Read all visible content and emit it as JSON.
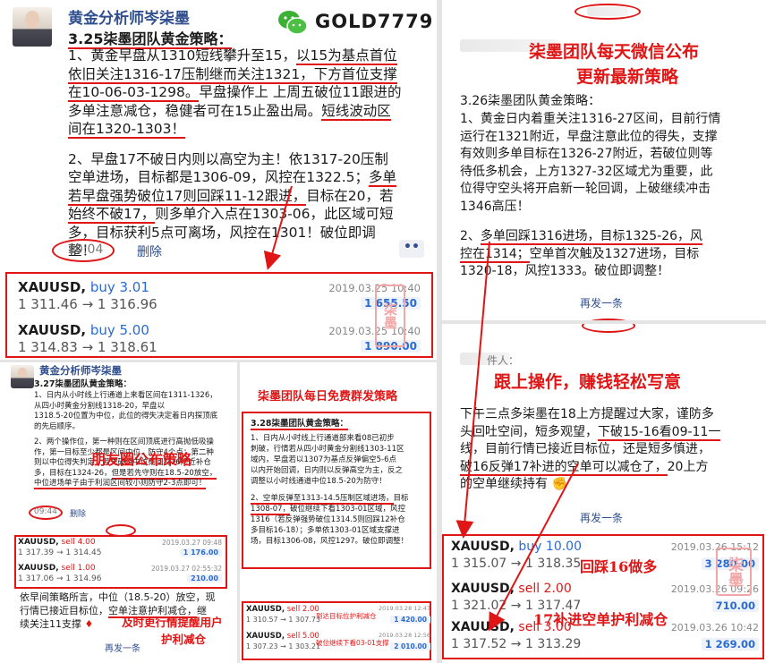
{
  "p1": {
    "author": "黄金分析师岑柒墨",
    "brand_wechat": "GOLD7779",
    "title": "3.25柒墨团队黄金策略：",
    "l1": "1、黄金早盘从1310短线攀升至15，",
    "l1u": "以15为基点首位",
    "l2u1": "依旧关注1316-17压制继而关注1321，",
    "l2u2": "下方首位支撑",
    "l3u": "在10-06-03-1298。",
    "l3": "早盘操作上 上周五破位11跟进的",
    "l4": "多单注意减仓，稳健者可在15止盈出局。",
    "l4u": "短线波动区",
    "l5u": "间在1320-1303！",
    "l6": "2、早盘17不破日内则以高空为主！依1317-20压制",
    "l7": "空单进场，目标都是1306-09，风控在1322.5；",
    "l7u": "多单",
    "l8u": "若早盘强势破位17则回踩11-12跟进，",
    "l8": "目标在20，若",
    "l9u": "始终不破17，",
    "l9": "则多单介入点在1303-06，此区域可短",
    "l10": "多，目标获利5点可离场，风控在1301！破位即调",
    "l11": "整！",
    "time": "10:04",
    "delete": "删除"
  },
  "trades_top": [
    {
      "symbol": "XAUUSD,",
      "side": "buy 3.01",
      "price": "1 311.46 → 1 316.96",
      "date": "2019.03.25 10:40",
      "profit": "1 655.50"
    },
    {
      "symbol": "XAUUSD,",
      "side": "buy 5.00",
      "price": "1 314.83 → 1 318.61",
      "date": "2019.03.25 10:40",
      "profit": "1 890.00"
    }
  ],
  "p2": {
    "author": "黄金分析师岑柒墨",
    "title": "3.27柒墨团队黄金策略：",
    "t1": "1、日内从小时线上行通道上来看区间在1311-1326，",
    "t2": "从四小时黄金分割线1318-20，早盘以",
    "t3": "1318.5-20位置为中位，此位的得失决定着日内探顶底",
    "t4": "的先后顺序。",
    "t5": "2、两个操作位，第一种则在区间顶底进行高抛低吸操",
    "t6": "作，第一目标至少都是区间中位，防守4个点；第二种",
    "t7": "则以中位得失判定，若先破位中位则回踩16附近补仓",
    "t8": "多，目标在1324-26，",
    "t8u": "但是若先守则在18.5-20放空，",
    "t9u": "中位进场单子由于利润区间较小则防守2-3点即可！",
    "annot": "朋友圈公布策略",
    "time": "09:44",
    "delete": "删除"
  },
  "trades_p2": [
    {
      "symbol": "XAUUSD,",
      "side": "sell 4.00",
      "price": "1 317.39 → 1 314.45",
      "date": "2019.03.27 09:48",
      "profit": "1 176.00"
    },
    {
      "symbol": "XAUUSD,",
      "side": "sell 1.00",
      "price": "1 317.06 → 1 314.96",
      "date": "2019.03.27 02:55:32",
      "profit": "210.00"
    }
  ],
  "p2foot": {
    "t1": "依早间策略所言，中位（18.5-20）放空，现",
    "t2": "行情已接近目标位，",
    "t2u": "空单注意护利减仓，",
    "t2b": "继",
    "t3": "续关注11支撑",
    "annot1": "及时更行情提醒用户",
    "annot2": "护利减仓",
    "more": "再发一条"
  },
  "p3": {
    "annot": "柒墨团队每日免费群发策略",
    "title": "3.28柒墨团队黄金策略：",
    "t1": "1、日内从小时线上行通道部来看08已初步",
    "t2": "刺破，行情若从四小时黄金分割线1303-11区",
    "t3": "域内，早盘若以1307为基点反弹偏空5-6点",
    "t4": "以内开始回调，日内则以反弹高空为主，反之",
    "t5": "调整以小时线通道中位18.5-20为防守！",
    "t6": "2、空单反弹至1313-14.5压制区域进场，",
    "t6b": "目标",
    "t7u": "1308-07，",
    "t7": "破位继续下看1303-01区域，风控",
    "t8": "1316（若反弹强势破位1314.5则回踩12补仓",
    "t9": "多目标16-18）；多单依1303-01区域支撑进",
    "t10": "场，目标1306-08，风控1297。破位即调整！"
  },
  "trades_p3": [
    {
      "symbol": "XAUUSD,",
      "side": "sell 2.00",
      "price": "1 310.57 → 1 307.73",
      "annot": "到达目标位护利减仓",
      "date": "2019.03.28 12:47",
      "profit": "1 420.00"
    },
    {
      "symbol": "XAUUSD,",
      "side": "sell 5.00",
      "price": "1 307.23 → 1 303.21",
      "annot": "破位继续下看03-01支撑",
      "date": "2019.03.28 12:56",
      "profit": "2 010.00"
    }
  ],
  "p4": {
    "date_blur": "2019.03.26",
    "annot1": "柒墨团队每天微信公布",
    "annot2": "更新最新策略",
    "title": "3.26柒墨团队黄金策略：",
    "t1": "1、黄金日内着重关注1316-27区间，目前行情",
    "t2": "运行在1321附近，早盘注意此位的得失，支撑",
    "t3": "有效则多单目标在1326-27附近，若破位则等",
    "t4": "待低多机会，上方1327-32区域尤为重要，此",
    "t5": "位得守空头将开启新一轮回调，上破继续冲击",
    "t6": "1346高压！",
    "t7a": "2、",
    "t7u": "多单回踩1316进场，目标1325-26，风",
    "t8u": "控在1314；",
    "t8": "空单首次触及1327进场，目标",
    "t9": "1320-18，风控1333。破位即调整！",
    "more": "再发一条"
  },
  "p5": {
    "header": "件人：",
    "annot": "跟上操作，赚钱轻松写意",
    "t1": "下午三点多柒墨在18上方提醒过大家，谨防多",
    "t2": "头回吐空间，短多观望，",
    "t2u": "下破15-16看09-11一",
    "t3": "线，",
    "t3b": "目前行情已接近目标位，还是短多慎进，",
    "t4u": "破16反弹17补进的空单可以减仓了，",
    "t4": "20上方",
    "t5": "的空单继续持有",
    "more": "再发一条"
  },
  "trades_right": [
    {
      "symbol": "XAUUSD,",
      "side": "buy 10.00",
      "price": "1 315.07 → 1 318.35",
      "date": "2019.03.26 15:12",
      "profit": "3 280.00",
      "annot": "回踩16做多"
    },
    {
      "symbol": "XAUUSD,",
      "side": "sell 2.00",
      "price": "1 321.02 → 1 317.47",
      "date": "2019.03.26 09:26",
      "profit": "710.00"
    },
    {
      "symbol": "XAUUSD,",
      "side": "sell 3.00",
      "price": "1 317.52 → 1 313.29",
      "date": "2019.03.26 10:42",
      "profit": "1 269.00",
      "annot": "17补进空单护利减仓"
    }
  ],
  "stamp": "柒墨",
  "colors": {
    "accent_red": "#e01515",
    "name_blue": "#2f4f8f",
    "buy_blue": "#2a6ad4"
  }
}
